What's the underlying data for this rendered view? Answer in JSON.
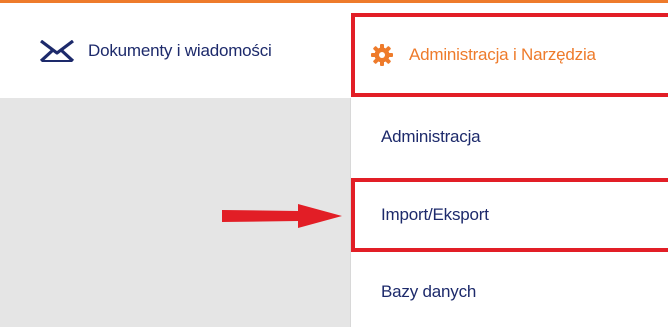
{
  "navbar": {
    "documents_label": "Dokumenty i wiadomości",
    "admin_label": "Administracja i Narzędzia"
  },
  "dropdown": {
    "items": [
      {
        "label": "Administracja"
      },
      {
        "label": "Import/Eksport"
      },
      {
        "label": "Bazy danych"
      }
    ]
  },
  "icons": {
    "documents": "envelope-icon",
    "admin": "gear-icon",
    "pointer": "right-arrow-icon"
  },
  "colors": {
    "accent_orange": "#ee7b2b",
    "highlight_red": "#e21e26",
    "text_navy": "#1d2a6b",
    "gray_background": "#e5e5e5"
  }
}
